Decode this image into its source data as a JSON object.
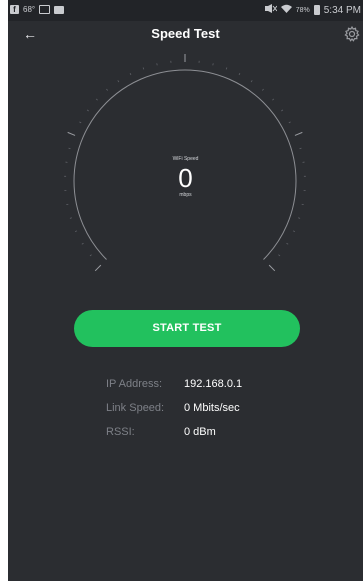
{
  "status_bar": {
    "left_temp": "68°",
    "time": "5:34 PM",
    "battery": "78%"
  },
  "app_bar": {
    "title": "Speed Test",
    "back_icon": "arrow-left-icon",
    "settings_icon": "gear-icon"
  },
  "gauge": {
    "label": "WiFi Speed",
    "value": "0",
    "unit": "mbps"
  },
  "start_button": {
    "label": "START TEST"
  },
  "info": {
    "rows": [
      {
        "label": "IP Address:",
        "value": "192.168.0.1"
      },
      {
        "label": "Link Speed:",
        "value": "0 Mbits/sec"
      },
      {
        "label": "RSSI:",
        "value": "0 dBm"
      }
    ]
  },
  "colors": {
    "background": "#2b2d31",
    "status_bar": "#222428",
    "accent": "#22c15e",
    "label": "#7d8087",
    "text": "#ffffff"
  }
}
